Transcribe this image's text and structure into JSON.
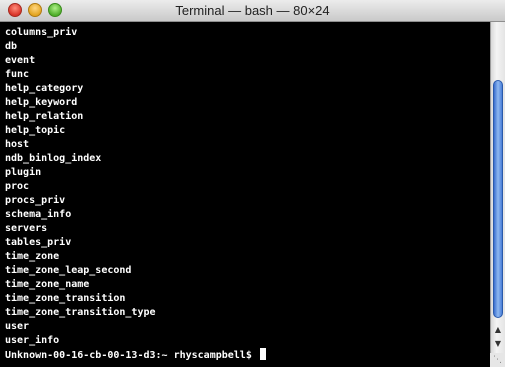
{
  "window": {
    "title": "Terminal — bash — 80×24"
  },
  "terminal": {
    "lines": [
      "columns_priv",
      "db",
      "event",
      "func",
      "help_category",
      "help_keyword",
      "help_relation",
      "help_topic",
      "host",
      "ndb_binlog_index",
      "plugin",
      "proc",
      "procs_priv",
      "schema_info",
      "servers",
      "tables_priv",
      "time_zone",
      "time_zone_leap_second",
      "time_zone_name",
      "time_zone_transition",
      "time_zone_transition_type",
      "user",
      "user_info"
    ],
    "prompt": "Unknown-00-16-cb-00-13-d3:~ rhyscampbell$ "
  },
  "scrollbar": {
    "up_arrow_icon": "scroll-up-arrow-icon",
    "down_arrow_icon": "scroll-down-arrow-icon"
  },
  "colors": {
    "terminal_background": "#000000",
    "terminal_text": "#ffffff",
    "scroll_thumb": "#4a7fd8"
  }
}
